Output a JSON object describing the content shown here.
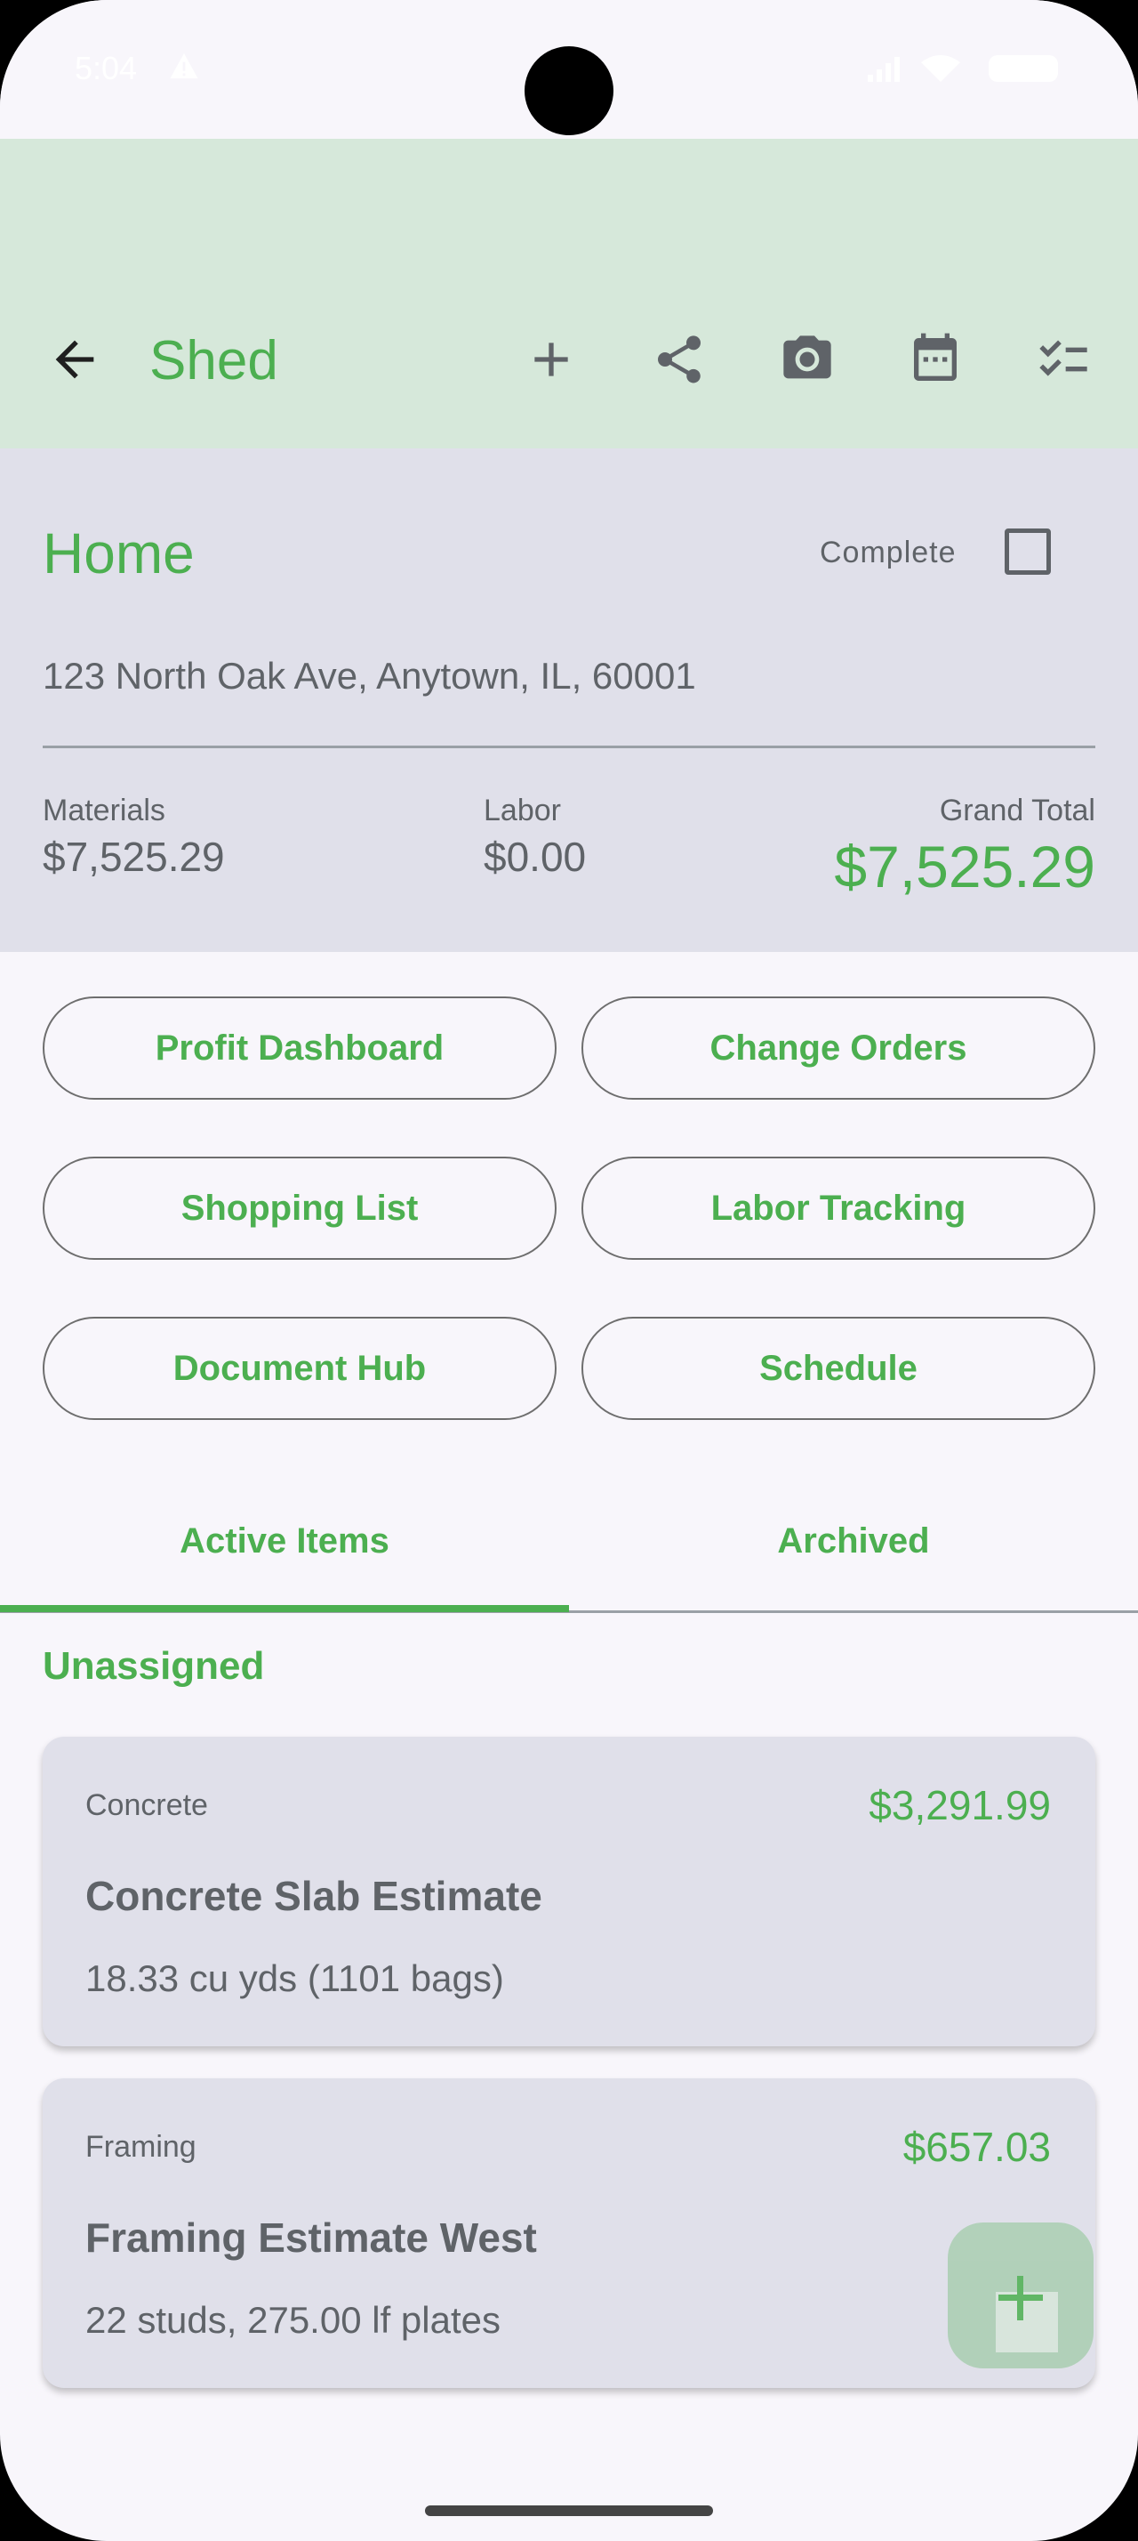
{
  "status_bar": {
    "time": "5:04"
  },
  "app_bar": {
    "title": "Shed",
    "icons": [
      "back-arrow-icon",
      "add-icon",
      "share-icon",
      "camera-icon",
      "calendar-icon",
      "checklist-icon"
    ]
  },
  "project": {
    "name": "Home",
    "complete_label": "Complete",
    "complete_checked": false,
    "address": "123 North Oak Ave, Anytown, IL, 60001",
    "materials_label": "Materials",
    "materials_value": "$7,525.29",
    "labor_label": "Labor",
    "labor_value": "$0.00",
    "grand_total_label": "Grand Total",
    "grand_total_value": "$7,525.29"
  },
  "buttons": {
    "profit_dashboard": "Profit Dashboard",
    "change_orders": "Change Orders",
    "shopping_list": "Shopping List",
    "labor_tracking": "Labor Tracking",
    "document_hub": "Document Hub",
    "schedule": "Schedule"
  },
  "tabs": {
    "active": "Active Items",
    "archived": "Archived",
    "selected": "Active Items"
  },
  "section": {
    "heading": "Unassigned"
  },
  "cards": [
    {
      "category": "Concrete",
      "price": "$3,291.99",
      "title": "Concrete Slab Estimate",
      "detail": "18.33 cu yds (1101 bags)"
    },
    {
      "category": "Framing",
      "price": "$657.03",
      "title": "Framing Estimate West",
      "detail": "22 studs, 275.00 lf plates"
    }
  ],
  "colors": {
    "accent": "#4caf50",
    "app_bar_bg": "#d6e8da",
    "panel_bg": "#e0e0ea",
    "page_bg": "#f8f6fb"
  }
}
